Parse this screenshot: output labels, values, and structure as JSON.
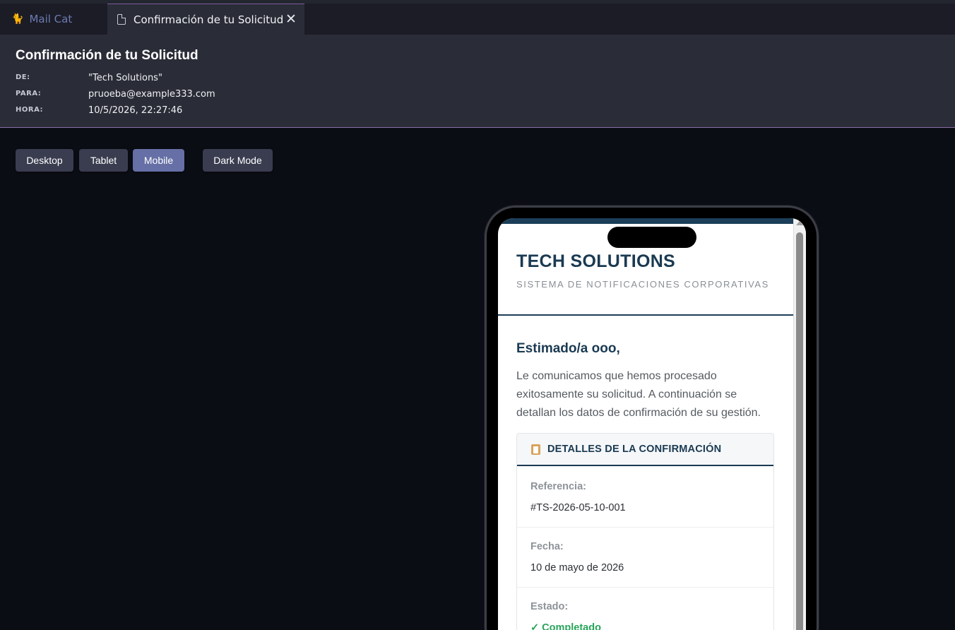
{
  "tabs": [
    {
      "label": "Mail Cat",
      "icon": "cat-icon"
    },
    {
      "label": "Confirmación de tu Solicitud",
      "icon": "document-icon",
      "close": "✕"
    }
  ],
  "header": {
    "subject": "Confirmación de tu Solicitud",
    "from_label": "DE:",
    "from_value": "\"Tech Solutions\"",
    "to_label": "PARA:",
    "to_value": "pruoeba@example333.com",
    "time_label": "HORA:",
    "time_value": "10/5/2026, 22:27:46"
  },
  "view_buttons": {
    "desktop": "Desktop",
    "tablet": "Tablet",
    "mobile": "Mobile",
    "dark": "Dark Mode",
    "selected": "Mobile"
  },
  "email": {
    "brand": "TECH SOLUTIONS",
    "tagline": "SISTEMA DE NOTIFICACIONES CORPORATIVAS",
    "greeting": "Estimado/a ooo,",
    "intro": "Le comunicamos que hemos procesado exitosamente su solicitud. A continuación se detallan los datos de confirmación de su gestión.",
    "details_title": "DETALLES DE LA CONFIRMACIÓN",
    "rows": [
      {
        "label": "Referencia:",
        "value": "#TS-2026-05-10-001"
      },
      {
        "label": "Fecha:",
        "value": "10 de mayo de 2026"
      },
      {
        "label": "Estado:",
        "value": "✓ Completado"
      }
    ]
  },
  "colors": {
    "brand": "#1a3a52",
    "accent_button": "#6670a6",
    "status_ok": "#27a55a"
  }
}
